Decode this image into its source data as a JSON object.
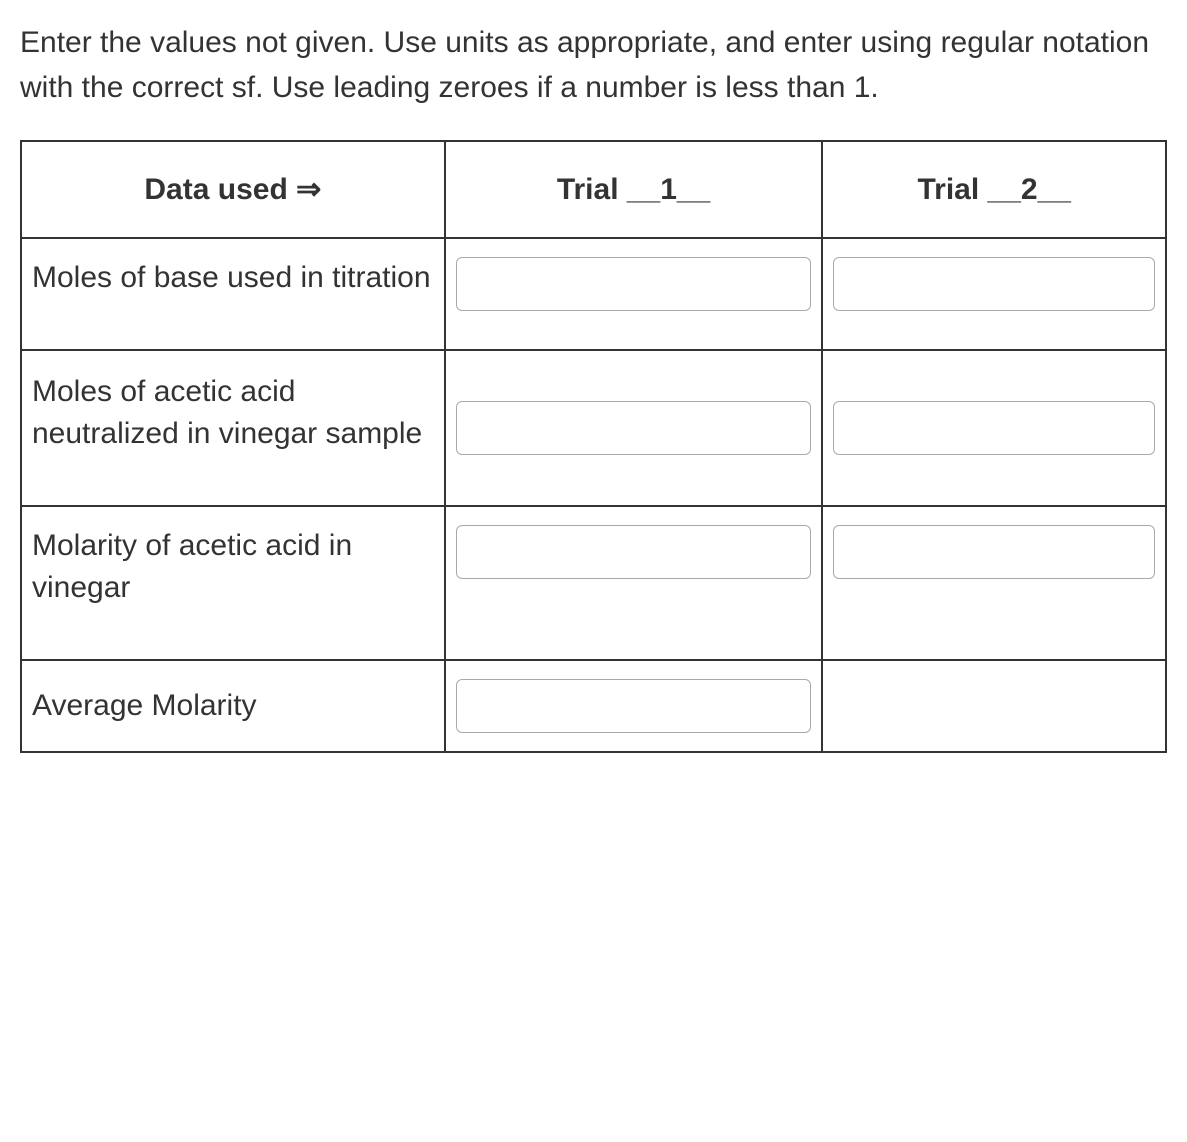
{
  "instructions": "Enter the values not given. Use units as appropriate, and enter using regular notation with the correct sf.  Use leading zeroes if a number is less than 1.",
  "table": {
    "header": {
      "data_used": "Data used ⇒",
      "trial1": "Trial __1__",
      "trial2": "Trial __2__"
    },
    "rows": [
      {
        "label": "Moles of base used in titration",
        "trial1_value": "",
        "trial2_value": ""
      },
      {
        "label": "Moles of acetic acid neutralized in vinegar sample",
        "trial1_value": "",
        "trial2_value": ""
      },
      {
        "label": "Molarity of acetic acid in vinegar",
        "trial1_value": "",
        "trial2_value": ""
      },
      {
        "label": "Average Molarity",
        "trial1_value": "",
        "trial2_value": null
      }
    ]
  }
}
